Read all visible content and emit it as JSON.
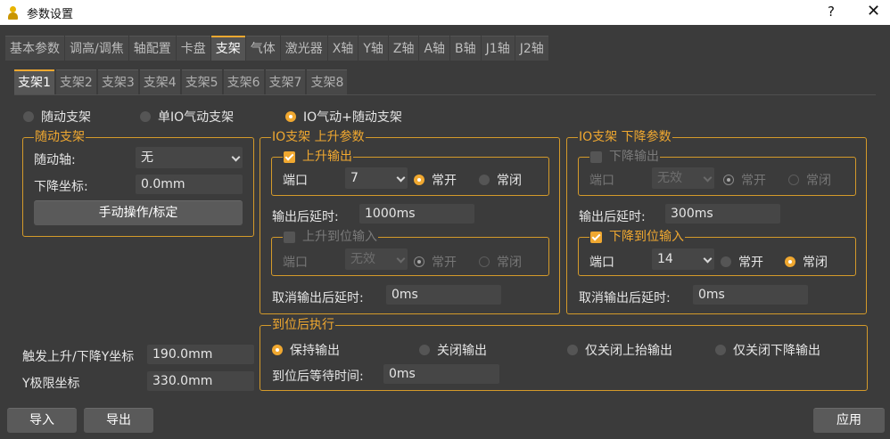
{
  "window": {
    "title": "参数设置",
    "help": "?",
    "close": "✕"
  },
  "main_tabs": [
    "基本参数",
    "调高/调焦",
    "轴配置",
    "卡盘",
    "支架",
    "气体",
    "激光器",
    "X轴",
    "Y轴",
    "Z轴",
    "A轴",
    "B轴",
    "J1轴",
    "J2轴"
  ],
  "main_tab_active": "支架",
  "sub_tabs": [
    "支架1",
    "支架2",
    "支架3",
    "支架4",
    "支架5",
    "支架6",
    "支架7",
    "支架8"
  ],
  "sub_tab_active": "支架1",
  "mode": {
    "options": [
      "随动支架",
      "单IO气动支架",
      "IO气动+随动支架"
    ],
    "selected": "IO气动+随动支架"
  },
  "follow": {
    "title": "随动支架",
    "axis_label": "随动轴:",
    "axis_value": "无",
    "down_label": "下降坐标:",
    "down_value": "0.0mm",
    "manual_button": "手动操作/标定"
  },
  "trigger": {
    "label": "触发上升/下降Y坐标",
    "value": "190.0mm"
  },
  "ylimit": {
    "label": "Y极限坐标",
    "value": "330.0mm"
  },
  "io_up": {
    "title": "IO支架 上升参数",
    "output": {
      "title": "上升输出",
      "checked": true,
      "port_label": "端口",
      "port_value": "7",
      "no": "常开",
      "nc": "常闭",
      "selected": "常开"
    },
    "delay_label": "输出后延时:",
    "delay_value": "1000ms",
    "input": {
      "title": "上升到位输入",
      "checked": false,
      "port_label": "端口",
      "port_value": "无效",
      "no": "常开",
      "nc": "常闭",
      "selected": "常开"
    },
    "cancel_label": "取消输出后延时:",
    "cancel_value": "0ms"
  },
  "io_down": {
    "title": "IO支架 下降参数",
    "output": {
      "title": "下降输出",
      "checked": false,
      "port_label": "端口",
      "port_value": "无效",
      "no": "常开",
      "nc": "常闭",
      "selected": "常开"
    },
    "delay_label": "输出后延时:",
    "delay_value": "300ms",
    "input": {
      "title": "下降到位输入",
      "checked": true,
      "port_label": "端口",
      "port_value": "14",
      "no": "常开",
      "nc": "常闭",
      "selected": "常闭"
    },
    "cancel_label": "取消输出后延时:",
    "cancel_value": "0ms"
  },
  "after": {
    "title": "到位后执行",
    "options": [
      "保持输出",
      "关闭输出",
      "仅关闭上抬输出",
      "仅关闭下降输出"
    ],
    "selected": "保持输出",
    "wait_label": "到位后等待时间:",
    "wait_value": "0ms"
  },
  "buttons": {
    "import": "导入",
    "export": "导出",
    "apply": "应用"
  },
  "colors": {
    "accent": "#f0a830",
    "background": "#3b3b3b",
    "field": "#464646"
  }
}
